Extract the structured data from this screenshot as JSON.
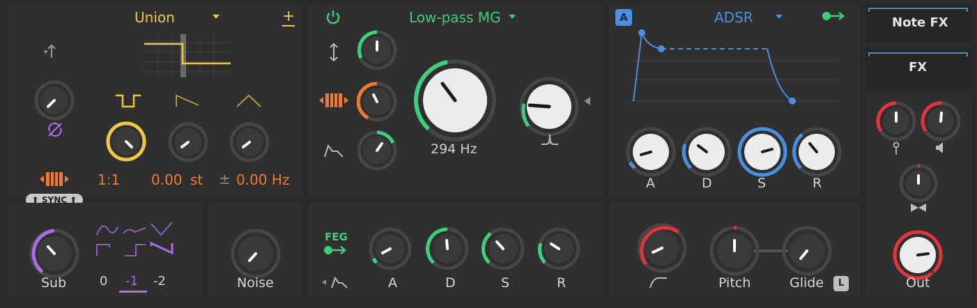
{
  "oscillator": {
    "mode_value": "Union",
    "sync_label": "SYNC",
    "ratio_value": "1:1",
    "semitone_value": "0.00",
    "semitone_unit": "st",
    "plusminus_symbol": "±",
    "hz_value": "0.00 Hz",
    "add_symbol": "+"
  },
  "sub": {
    "label": "Sub",
    "octaves": [
      "0",
      "-1",
      "-2"
    ],
    "selected_octave": "-1"
  },
  "noise": {
    "label": "Noise"
  },
  "filter": {
    "type_value": "Low-pass MG",
    "cutoff_value": "294 Hz"
  },
  "feg": {
    "label": "FEG",
    "knob_labels": [
      "A",
      "D",
      "S",
      "R"
    ]
  },
  "amp_env": {
    "badge": "A",
    "type_value": "ADSR",
    "knob_labels": [
      "A",
      "D",
      "S",
      "R"
    ]
  },
  "pitch": {
    "pitch_label": "Pitch",
    "glide_label": "Glide",
    "legato_badge": "L"
  },
  "right": {
    "note_fx_label": "Note FX",
    "fx_label": "FX",
    "out_label": "Out"
  },
  "colors": {
    "yellow": "#f2c744",
    "orange": "#f07a32",
    "green": "#3ecf7c",
    "blue": "#4a90e2",
    "purple": "#a96de8",
    "red": "#e0353e"
  }
}
